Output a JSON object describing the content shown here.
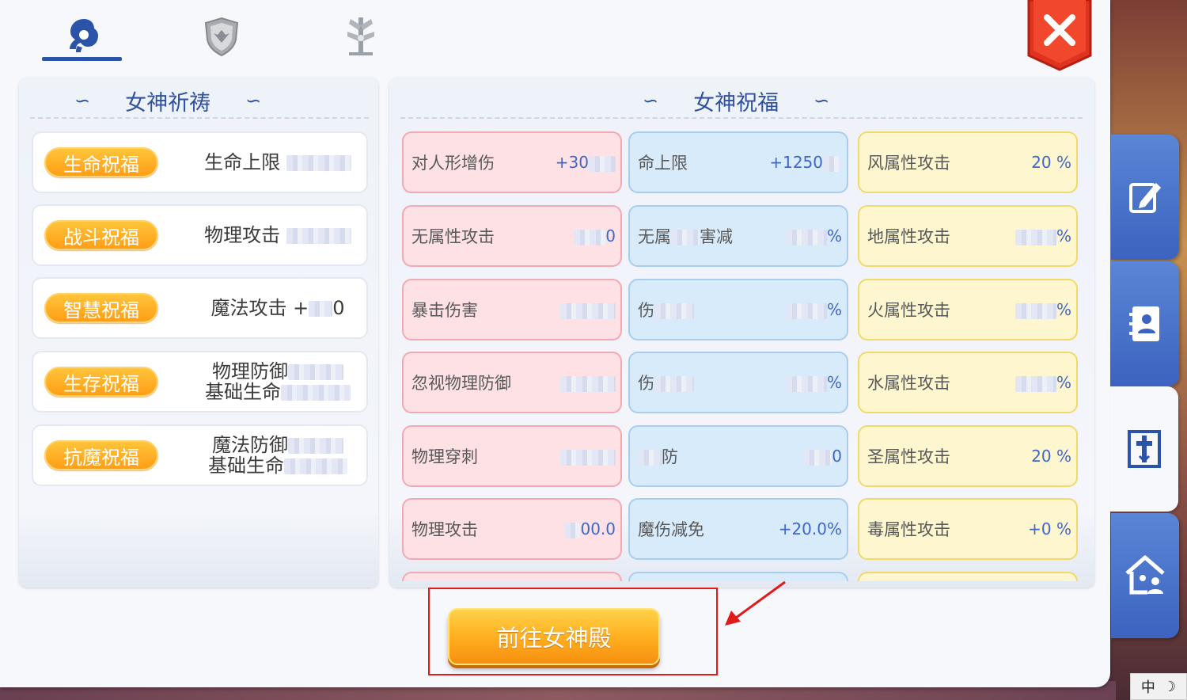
{
  "tabs": [
    {
      "id": "goddess",
      "icon": "goddess-silhouette-icon",
      "active": true
    },
    {
      "id": "shield",
      "icon": "shield-crest-icon",
      "active": false
    },
    {
      "id": "rune",
      "icon": "rune-tree-icon",
      "active": false
    }
  ],
  "left_panel": {
    "title": "女神祈祷",
    "rows": [
      {
        "tag": "生命祝福",
        "text": "生命上限 "
      },
      {
        "tag": "战斗祝福",
        "text": "物理攻击 "
      },
      {
        "tag": "智慧祝福",
        "text": "魔法攻击 +",
        "suffix": "0"
      },
      {
        "tag": "生存祝福",
        "line1": "物理防御",
        "line2": "基础生命"
      },
      {
        "tag": "抗魔祝福",
        "line1": "魔法防御",
        "line2": "基础生命"
      }
    ]
  },
  "right_panel": {
    "title": "女神祝福",
    "cols": [
      [
        {
          "label": "对人形增伤",
          "value": "+30"
        },
        {
          "label": "无属性攻击",
          "value": "0"
        },
        {
          "label": "暴击伤害",
          "value": ""
        },
        {
          "label": "忽视物理防御",
          "value": ""
        },
        {
          "label": "物理穿刺",
          "value": ""
        },
        {
          "label": "物理攻击",
          "value": "00.0"
        }
      ],
      [
        {
          "label": "命上限",
          "value": "+1250"
        },
        {
          "label": "无属",
          "label2": "害减",
          "value": "%"
        },
        {
          "label": "伤",
          "value": "%"
        },
        {
          "label": "伤",
          "value": "%"
        },
        {
          "label": "防",
          "value": "0"
        },
        {
          "label": "魔伤减免",
          "value": "+20.0%"
        }
      ],
      [
        {
          "label": "风属性攻击",
          "value": "20  %"
        },
        {
          "label": "地属性攻击",
          "value": "%"
        },
        {
          "label": "火属性攻击",
          "value": "%"
        },
        {
          "label": "水属性攻击",
          "value": "%"
        },
        {
          "label": "圣属性攻击",
          "value": "20  %"
        },
        {
          "label": "毒属性攻击",
          "value": "+0  %"
        }
      ]
    ]
  },
  "go_button": {
    "label": "前往女神殿"
  },
  "side_tabs": [
    {
      "icon": "edit-icon",
      "active": false
    },
    {
      "icon": "contact-book-icon",
      "active": false
    },
    {
      "icon": "cross-scroll-icon",
      "active": true
    },
    {
      "icon": "home-people-icon",
      "active": false
    }
  ],
  "ime": {
    "lang": "中",
    "mode": "moon-icon"
  },
  "colors": {
    "accent": "#30519e",
    "tag": "#ffa820",
    "pink": "#fde1e5",
    "blue": "#d7ebfb",
    "yellow": "#fdf6cf",
    "value": "#3f66c9"
  }
}
